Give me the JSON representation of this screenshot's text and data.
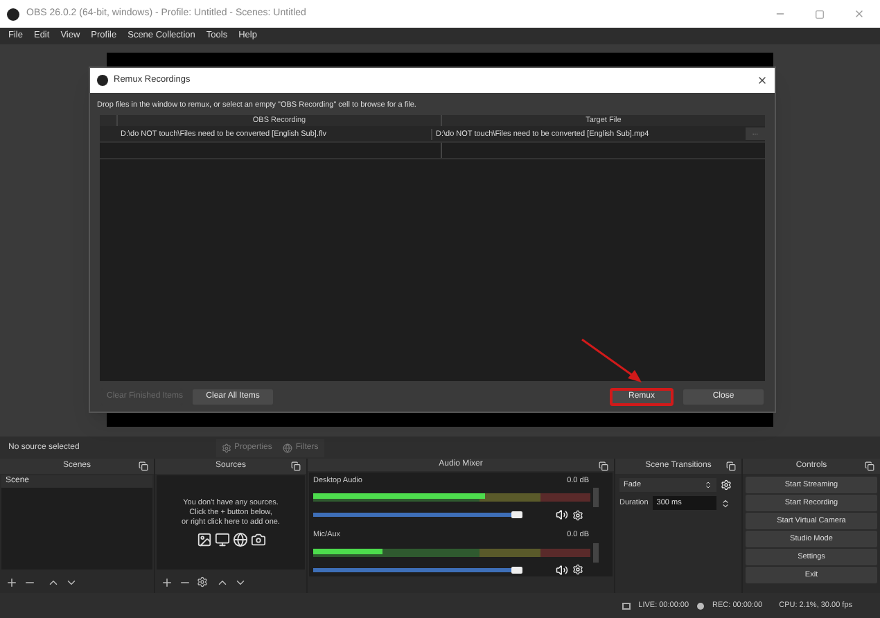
{
  "window": {
    "title": "OBS 26.0.2 (64-bit, windows) - Profile: Untitled - Scenes: Untitled"
  },
  "menu": [
    "File",
    "Edit",
    "View",
    "Profile",
    "Scene Collection",
    "Tools",
    "Help"
  ],
  "dialog": {
    "title": "Remux Recordings",
    "instructions": "Drop files in the window to remux, or select an empty \"OBS Recording\" cell to browse for a file.",
    "columns": [
      "OBS Recording",
      "Target File"
    ],
    "rows": [
      {
        "source": "D:\\do NOT touch\\Files need to be converted [English Sub].flv",
        "target": "D:\\do NOT touch\\Files need to be converted [English Sub].mp4",
        "browse": "..."
      }
    ],
    "left_buttons": [
      {
        "label": "Clear Finished Items",
        "disabled": true,
        "highlighted": false
      },
      {
        "label": "Clear All Items",
        "disabled": false,
        "highlighted": false
      }
    ],
    "right_buttons": [
      {
        "label": "Remux",
        "disabled": false,
        "highlighted": true
      },
      {
        "label": "Close",
        "disabled": false,
        "highlighted": false
      }
    ]
  },
  "source_bar": {
    "status": "No source selected",
    "buttons": [
      {
        "label": "Properties",
        "disabled": true
      },
      {
        "label": "Filters",
        "disabled": true
      }
    ]
  },
  "docks": {
    "scenes": {
      "title": "Scenes",
      "items": [
        {
          "label": "Scene",
          "selected": true
        }
      ]
    },
    "sources": {
      "title": "Sources",
      "empty_text": "You don't have any sources.\nClick the + button below,\nor right click here to add one."
    },
    "audio_mixer": {
      "title": "Audio Mixer",
      "channels": [
        {
          "name": "Desktop Audio",
          "reading": "0.0 dB",
          "meter": {
            "level": 0.62
          },
          "slider": {
            "level": 0.83
          }
        },
        {
          "name": "Mic/Aux",
          "reading": "0.0 dB",
          "meter": {
            "level": 0.25
          },
          "slider": {
            "level": 0.83
          }
        }
      ]
    },
    "scene_transitions": {
      "title": "Scene Transitions",
      "transition": "Fade",
      "duration_label": "Duration",
      "duration": "300 ms"
    },
    "controls": {
      "title": "Controls",
      "buttons": [
        "Start Streaming",
        "Start Recording",
        "Start Virtual Camera",
        "Studio Mode",
        "Settings",
        "Exit"
      ]
    }
  },
  "status_bar": {
    "live": "LIVE: 00:00:00",
    "rec": "REC: 00:00:00",
    "cpu": "CPU: 2.1%, 30.00 fps"
  }
}
